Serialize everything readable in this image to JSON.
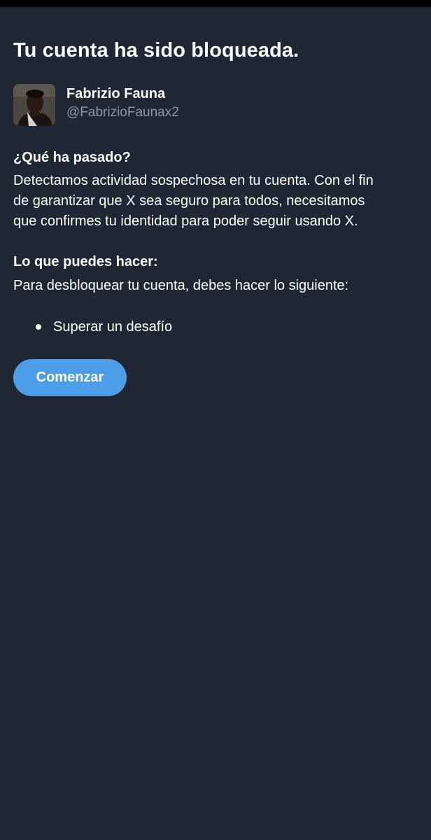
{
  "page": {
    "title": "Tu cuenta ha sido bloqueada."
  },
  "profile": {
    "name": "Fabrizio Fauna",
    "handle": "@FabrizioFaunax2",
    "avatar_icon": "profile-photo"
  },
  "what_happened": {
    "heading": "¿Qué ha pasado?",
    "lines": [
      "Detectamos actividad sospechosa en tu cuenta. Con el fin",
      "de garantizar que X sea seguro para todos, necesitamos",
      "que confirmes tu identidad para poder seguir usando X."
    ]
  },
  "what_you_can_do": {
    "heading": "Lo que puedes hacer:",
    "text": "Para desbloquear tu cuenta, debes hacer lo siguiente:",
    "steps": [
      "Superar un desafío"
    ]
  },
  "actions": {
    "start_label": "Comenzar"
  },
  "colors": {
    "background": "#1e2733",
    "accent": "#4d9de9",
    "secondary_text": "#8b98a5"
  }
}
